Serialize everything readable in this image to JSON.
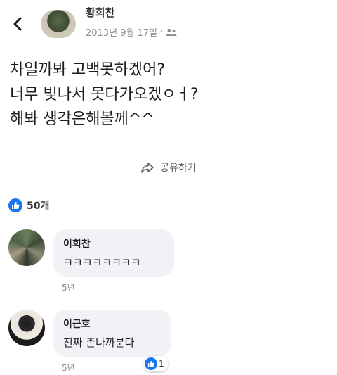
{
  "header": {
    "author": "황희찬",
    "date": "2013년 9월 17일",
    "separator": "·",
    "privacy_icon": "friends-icon"
  },
  "post": {
    "lines": [
      "차일까봐 고백못하겠어?",
      "너무 빛나서 못다가오겠ㅇㅓ?",
      "해봐 생각은해볼께^^"
    ]
  },
  "share": {
    "label": "공유하기",
    "icon": "share-arrow-icon"
  },
  "reactions": {
    "count": "50개",
    "icon": "like-icon",
    "color": "#1877f2"
  },
  "comments": [
    {
      "name": "이희찬",
      "text": "ㅋㅋㅋㅋㅋㅋㅋㅋ",
      "time": "5년"
    },
    {
      "name": "이근호",
      "text": "진짜 존나까분다",
      "time": "5년",
      "likes": "1"
    }
  ]
}
